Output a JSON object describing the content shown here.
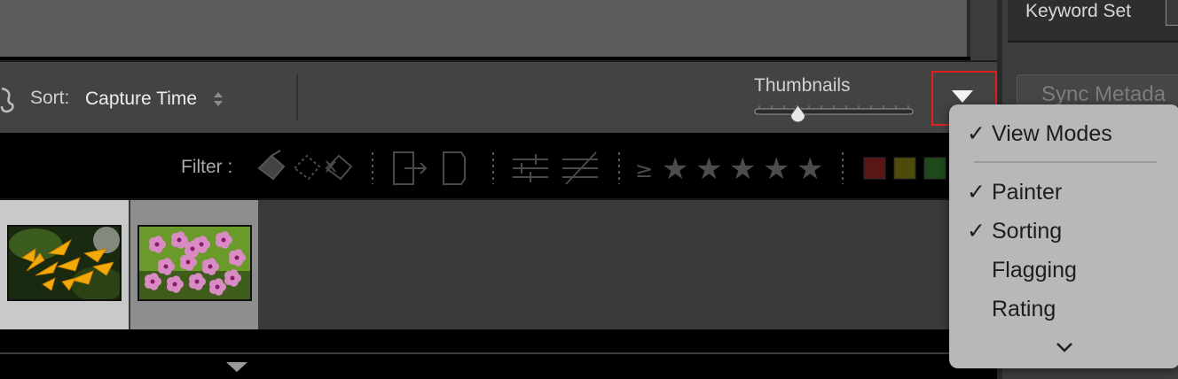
{
  "right_panel": {
    "keyword_label": "Keyword Set",
    "sync_label": "Sync Metada"
  },
  "toolbar": {
    "sort_label": "Sort:",
    "sort_value": "Capture Time",
    "thumbnails_label": "Thumbnails",
    "thumbnail_slider_value": 0.27
  },
  "filter_bar": {
    "label": "Filter :",
    "rating_operator": "≥",
    "stars": [
      "★",
      "★",
      "★",
      "★",
      "★"
    ],
    "color_labels": [
      "#5a1616",
      "#4d4a0c",
      "#1e4a1c"
    ]
  },
  "filmstrip": {
    "items": [
      {
        "name": "yellow-flowers-photo",
        "selected": true
      },
      {
        "name": "pink-flowers-photo",
        "selected": false
      }
    ]
  },
  "menu": {
    "items": [
      {
        "label": "View Modes",
        "checked": true
      },
      {
        "label": "Painter",
        "checked": true
      },
      {
        "label": "Sorting",
        "checked": true
      },
      {
        "label": "Flagging",
        "checked": false
      },
      {
        "label": "Rating",
        "checked": false
      }
    ],
    "check_glyph": "✓"
  }
}
